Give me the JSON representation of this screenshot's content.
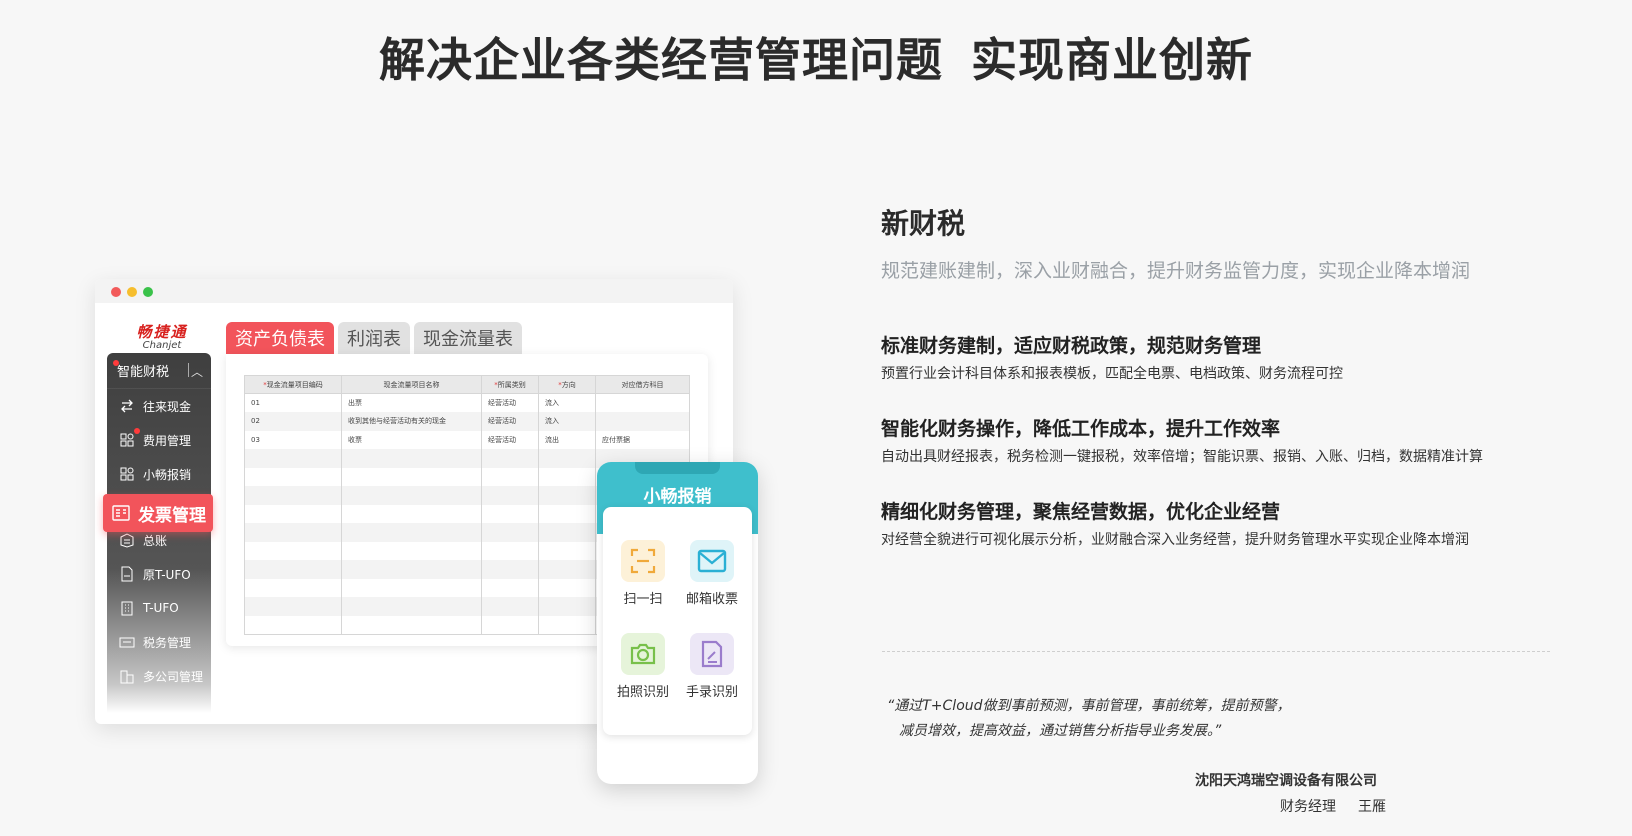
{
  "headline": {
    "part1": "解决企业各类经营管理问题",
    "part2": "实现商业创新"
  },
  "app": {
    "brand_cn": "畅捷通",
    "brand_en": "Chanjet",
    "sidebar": {
      "header": "智能财税",
      "items": [
        "往来现金",
        "费用管理",
        "小畅报销",
        "发票管理",
        "总账",
        "原T-UFO",
        "T-UFO",
        "税务管理",
        "多公司管理"
      ]
    },
    "tabs": [
      "资产负债表",
      "利润表",
      "现金流量表"
    ],
    "table": {
      "headers": [
        "现金流量项目编码",
        "现金流量项目名称",
        "所属类别",
        "方向",
        "对应借方科目"
      ],
      "rows": [
        [
          "01",
          "出票",
          "经营活动",
          "流入",
          ""
        ],
        [
          "02",
          "收到其他与经营活动有关的现金",
          "经营活动",
          "流入",
          ""
        ],
        [
          "03",
          "收票",
          "经营活动",
          "流出",
          "应付票据"
        ]
      ]
    }
  },
  "phone": {
    "title": "小畅报销",
    "features": [
      "扫一扫",
      "邮箱收票",
      "拍照识别",
      "手录识别"
    ]
  },
  "right": {
    "title": "新财税",
    "subtitle": "规范建账建制，深入业财融合，提升财务监管力度，实现企业降本增润",
    "features": [
      {
        "heading": "标准财务建制，适应财税政策，规范财务管理",
        "desc": "预置行业会计科目体系和报表模板，匹配全电票、电档政策、财务流程可控"
      },
      {
        "heading": "智能化财务操作，降低工作成本，提升工作效率",
        "desc": "自动出具财经报表，税务检测一键报税，效率倍增；智能识票、报销、入账、归档，数据精准计算"
      },
      {
        "heading": "精细化财务管理，聚焦经营数据，优化企业经营",
        "desc": "对经营全貌进行可视化展示分析，业财融合深入业务经营，提升财务管理水平实现企业降本增润"
      }
    ],
    "quote_line1": "“通过T+Cloud做到事前预测，事前管理，事前统筹，提前预警，",
    "quote_line2": "减员增效，提高效益，通过销售分析指导业务发展。”",
    "company": "沈阳天鸿瑞空调设备有限公司",
    "role": "财务经理",
    "person": "王雁"
  },
  "colors": {
    "accent_red": "#f2545b",
    "phone_teal": "#3fbfcc",
    "brand_red": "#d8221f"
  }
}
